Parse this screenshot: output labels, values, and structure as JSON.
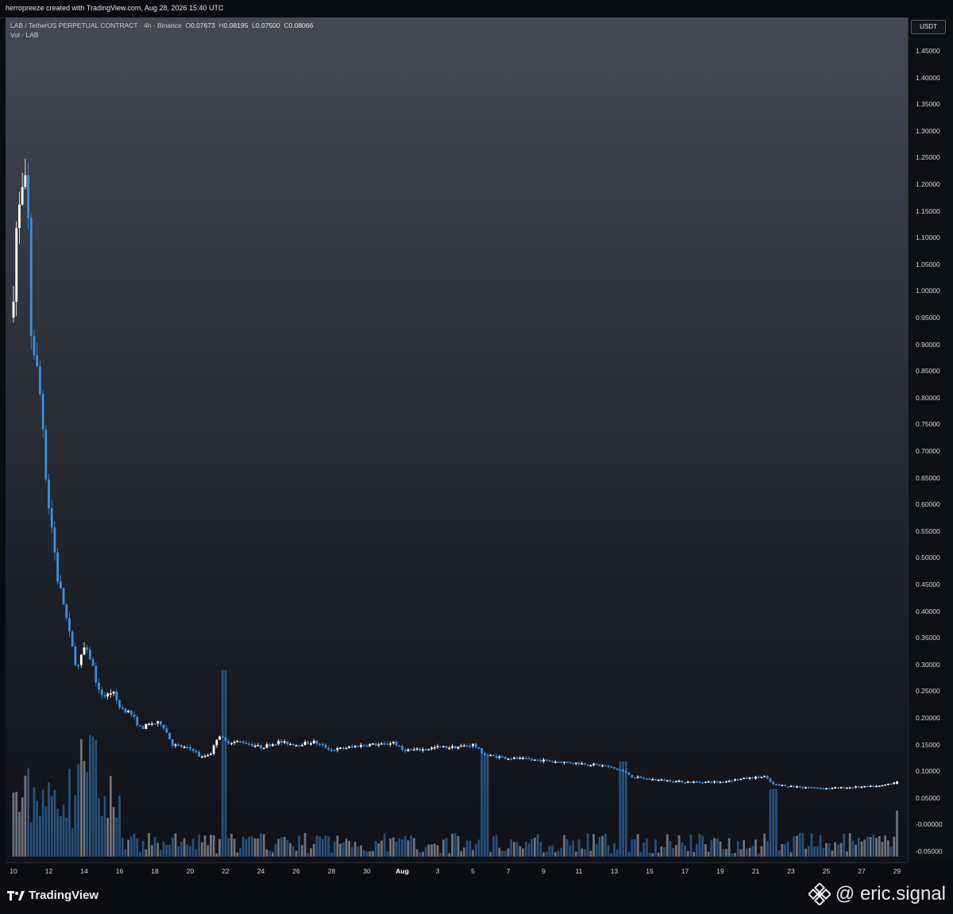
{
  "header": {
    "attribution": "herropreeze created with TradingView.com, Aug 28, 2026 15:40 UTC"
  },
  "legend": {
    "symbol": "LAB / TetherUS PERPETUAL CONTRACT · 4h · Binance",
    "open_label": "O",
    "open": "0.07673",
    "high_label": "H",
    "high": "0.08195",
    "low_label": "L",
    "low": "0.07500",
    "close_label": "C",
    "close": "0.08066",
    "volume_label": "Vol · LAB"
  },
  "price_axis": {
    "currency": "USDT"
  },
  "colors": {
    "up_candle": "#ffffff",
    "down_candle": "#3d8fe0",
    "volume_up": "#7f828c",
    "volume_down": "#2b5a8c",
    "background_top": "#464853",
    "background_bottom": "#111219"
  },
  "chart_data": {
    "type": "candlestick",
    "interval": "4h",
    "ylim": [
      -0.06,
      1.48
    ],
    "y_ticks": [
      "1.45000",
      "1.40000",
      "1.35000",
      "1.30000",
      "1.25000",
      "1.20000",
      "1.15000",
      "1.10000",
      "1.05000",
      "1.00000",
      "0.95000",
      "0.90000",
      "0.85000",
      "0.80000",
      "0.75000",
      "0.70000",
      "0.65000",
      "0.60000",
      "0.55000",
      "0.50000",
      "0.45000",
      "0.40000",
      "0.35000",
      "0.30000",
      "0.25000",
      "0.20000",
      "0.15000",
      "0.10000",
      "0.05000",
      "-0.00000",
      "-0.05000"
    ],
    "x_ticks": [
      {
        "label": "10",
        "day": 10
      },
      {
        "label": "12",
        "day": 12
      },
      {
        "label": "14",
        "day": 14
      },
      {
        "label": "16",
        "day": 16
      },
      {
        "label": "18",
        "day": 18
      },
      {
        "label": "20",
        "day": 20
      },
      {
        "label": "22",
        "day": 22
      },
      {
        "label": "24",
        "day": 24
      },
      {
        "label": "26",
        "day": 26
      },
      {
        "label": "28",
        "day": 28
      },
      {
        "label": "30",
        "day": 30
      },
      {
        "label": "Aug",
        "day": 32,
        "bold": true
      },
      {
        "label": "3",
        "day": 34
      },
      {
        "label": "5",
        "day": 36
      },
      {
        "label": "7",
        "day": 38
      },
      {
        "label": "9",
        "day": 40
      },
      {
        "label": "11",
        "day": 42
      },
      {
        "label": "13",
        "day": 44
      },
      {
        "label": "15",
        "day": 46
      },
      {
        "label": "17",
        "day": 48
      },
      {
        "label": "19",
        "day": 50
      },
      {
        "label": "21",
        "day": 52
      },
      {
        "label": "23",
        "day": 54
      },
      {
        "label": "25",
        "day": 56
      },
      {
        "label": "27",
        "day": 58
      },
      {
        "label": "29",
        "day": 60
      }
    ],
    "close_path": [
      {
        "day": 10.0,
        "close": 1.0
      },
      {
        "day": 10.2,
        "close": 1.14
      },
      {
        "day": 10.4,
        "close": 1.16
      },
      {
        "day": 10.6,
        "close": 1.21
      },
      {
        "day": 10.8,
        "close": 1.17
      },
      {
        "day": 11.0,
        "close": 0.92
      },
      {
        "day": 11.3,
        "close": 0.86
      },
      {
        "day": 11.6,
        "close": 0.78
      },
      {
        "day": 11.9,
        "close": 0.62
      },
      {
        "day": 12.2,
        "close": 0.55
      },
      {
        "day": 12.5,
        "close": 0.46
      },
      {
        "day": 12.8,
        "close": 0.42
      },
      {
        "day": 13.2,
        "close": 0.35
      },
      {
        "day": 13.6,
        "close": 0.29
      },
      {
        "day": 14.0,
        "close": 0.33
      },
      {
        "day": 14.4,
        "close": 0.31
      },
      {
        "day": 14.8,
        "close": 0.25
      },
      {
        "day": 15.2,
        "close": 0.24
      },
      {
        "day": 15.6,
        "close": 0.25
      },
      {
        "day": 16.0,
        "close": 0.22
      },
      {
        "day": 16.6,
        "close": 0.21
      },
      {
        "day": 17.2,
        "close": 0.18
      },
      {
        "day": 17.8,
        "close": 0.19
      },
      {
        "day": 18.4,
        "close": 0.19
      },
      {
        "day": 19.0,
        "close": 0.15
      },
      {
        "day": 19.6,
        "close": 0.145
      },
      {
        "day": 20.2,
        "close": 0.14
      },
      {
        "day": 20.6,
        "close": 0.125
      },
      {
        "day": 21.2,
        "close": 0.135
      },
      {
        "day": 21.6,
        "close": 0.17
      },
      {
        "day": 22.0,
        "close": 0.155
      },
      {
        "day": 23.0,
        "close": 0.155
      },
      {
        "day": 24.0,
        "close": 0.145
      },
      {
        "day": 25.0,
        "close": 0.155
      },
      {
        "day": 26.0,
        "close": 0.15
      },
      {
        "day": 27.0,
        "close": 0.155
      },
      {
        "day": 28.0,
        "close": 0.14
      },
      {
        "day": 29.0,
        "close": 0.145
      },
      {
        "day": 30.0,
        "close": 0.15
      },
      {
        "day": 31.0,
        "close": 0.15
      },
      {
        "day": 31.5,
        "close": 0.155
      },
      {
        "day": 32.0,
        "close": 0.14
      },
      {
        "day": 33.0,
        "close": 0.14
      },
      {
        "day": 34.0,
        "close": 0.145
      },
      {
        "day": 35.0,
        "close": 0.145
      },
      {
        "day": 36.0,
        "close": 0.15
      },
      {
        "day": 36.7,
        "close": 0.13
      },
      {
        "day": 38.0,
        "close": 0.125
      },
      {
        "day": 40.0,
        "close": 0.12
      },
      {
        "day": 42.0,
        "close": 0.115
      },
      {
        "day": 43.5,
        "close": 0.11
      },
      {
        "day": 44.5,
        "close": 0.1
      },
      {
        "day": 45.0,
        "close": 0.09
      },
      {
        "day": 46.0,
        "close": 0.085
      },
      {
        "day": 48.0,
        "close": 0.08
      },
      {
        "day": 50.0,
        "close": 0.08
      },
      {
        "day": 51.0,
        "close": 0.085
      },
      {
        "day": 52.5,
        "close": 0.09
      },
      {
        "day": 53.0,
        "close": 0.075
      },
      {
        "day": 54.0,
        "close": 0.072
      },
      {
        "day": 56.0,
        "close": 0.068
      },
      {
        "day": 57.5,
        "close": 0.07
      },
      {
        "day": 59.0,
        "close": 0.072
      },
      {
        "day": 60.0,
        "close": 0.08066
      }
    ],
    "last_candle": {
      "open": 0.07673,
      "high": 0.08195,
      "low": 0.075,
      "close": 0.08066
    }
  },
  "footer": {
    "brand": "TradingView",
    "watermark": "@ eric.signal"
  }
}
